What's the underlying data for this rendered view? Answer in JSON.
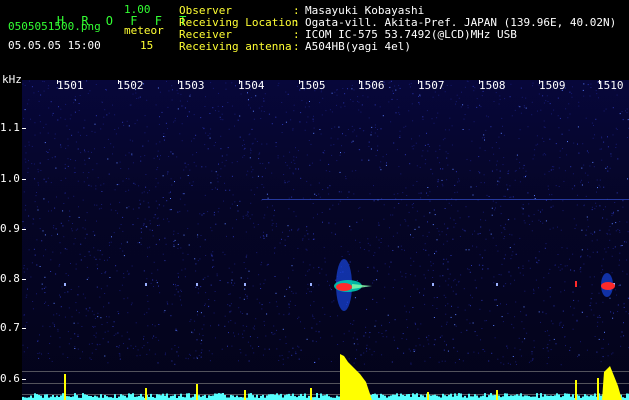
{
  "header": {
    "app_name": "H R O F F T",
    "version": "1.00",
    "filename": "0505051500.png",
    "datetime": "05.05.05 15:00",
    "meteor_label": "meteor",
    "meteor_count": "15"
  },
  "info": {
    "rows": [
      {
        "key": "Observer",
        "sep": ":",
        "value": "Masayuki Kobayashi"
      },
      {
        "key": "Receiving Location",
        "sep": ":",
        "value": "Ogata-vill. Akita-Pref. JAPAN (139.96E, 40.02N)"
      },
      {
        "key": "Receiver",
        "sep": ":",
        "value": "ICOM IC-575 53.7492(@LCD)MHz USB"
      },
      {
        "key": "Receiving antenna",
        "sep": ":",
        "value": "A504HB(yagi 4el)"
      }
    ]
  },
  "axis": {
    "unit": "kHz",
    "y_ticks": [
      "1.1",
      "1.0",
      "0.9",
      "0.8",
      "0.7",
      "0.6"
    ],
    "time_ticks": [
      "1501",
      "1502",
      "1503",
      "1504",
      "1505",
      "1506",
      "1507",
      "1508",
      "1509",
      "1510"
    ]
  },
  "colors": {
    "background": "#000000",
    "header_green": "#33ff33",
    "header_yellow": "#ffff33",
    "spectrogram_base": "#050526",
    "echo_red": "#ff2a2a",
    "level_yellow": "#ffff00",
    "noise_cyan": "#55ffff"
  }
}
